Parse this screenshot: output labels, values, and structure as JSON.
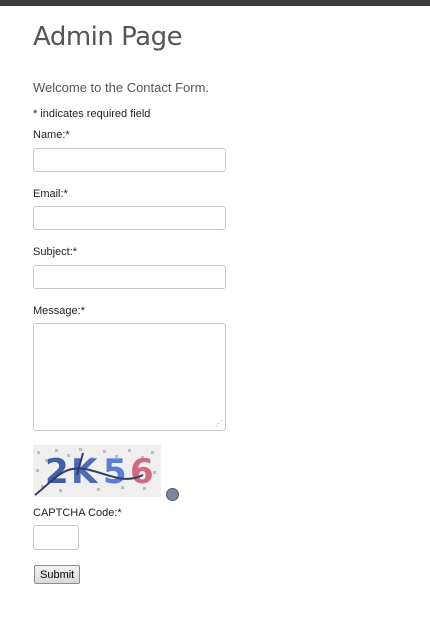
{
  "header": {
    "title": "Admin Page"
  },
  "form": {
    "welcome": "Welcome to the Contact Form.",
    "required_note": "* indicates required field",
    "fields": {
      "name": {
        "label": "Name:*",
        "value": ""
      },
      "email": {
        "label": "Email:*",
        "value": ""
      },
      "subject": {
        "label": "Subject:*",
        "value": ""
      },
      "message": {
        "label": "Message:*",
        "value": ""
      }
    },
    "captcha": {
      "image_text": "2K56",
      "label": "CAPTCHA Code:*",
      "value": ""
    },
    "submit_label": "Submit"
  },
  "colors": {
    "topbar": "#3d3d3d",
    "title": "#555555"
  },
  "icons": {
    "captcha_refresh": "refresh-icon",
    "textarea_resize": "resize-grip-icon"
  }
}
